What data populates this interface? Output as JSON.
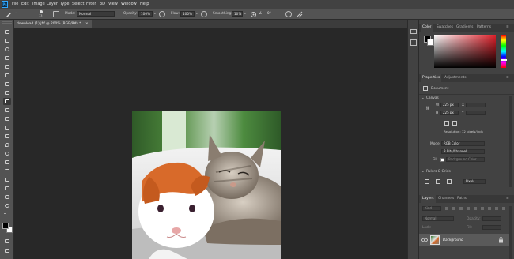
{
  "app": {
    "logo": "Ps"
  },
  "menu": [
    "File",
    "Edit",
    "Image",
    "Layer",
    "Type",
    "Select",
    "Filter",
    "3D",
    "View",
    "Window",
    "Help"
  ],
  "options": {
    "brush_size": "13",
    "mode_label": "Mode:",
    "mode_value": "Normal",
    "opacity_label": "Opacity:",
    "opacity_value": "100%",
    "flow_label": "Flow:",
    "flow_value": "100%",
    "smoothing_label": "Smoothing:",
    "smoothing_value": "10%",
    "angle_value": "0°"
  },
  "document": {
    "tab_title": "download (1).jfif @ 200% (RGB/8#) *",
    "close": "×"
  },
  "color_panel": {
    "tabs": [
      "Color",
      "Swatches",
      "Gradients",
      "Patterns"
    ],
    "foreground": "#000000",
    "background": "#ffffff"
  },
  "properties": {
    "tabs": [
      "Properties",
      "Adjustments"
    ],
    "doc_type": "Document",
    "canvas_header": "Canvas",
    "w_label": "W",
    "w_value": "225 px",
    "h_label": "H",
    "h_value": "225 px",
    "x_label": "X",
    "y_label": "Y",
    "resolution": "Resolution: 72 pixels/inch",
    "mode_label": "Mode",
    "mode_value": "RGB Color",
    "depth_value": "8 Bits/Channel",
    "fill_label": "Fill",
    "fill_value": "Background Color",
    "rulers_header": "Rulers & Grids",
    "units_value": "Pixels"
  },
  "layers": {
    "tabs": [
      "Layers",
      "Channels",
      "Paths"
    ],
    "kind_value": "Kind",
    "blend_value": "Normal",
    "opacity_label": "Opacity:",
    "fill_label": "Fill:",
    "lock_label": "Lock:",
    "layer_name": "Background"
  },
  "icons": [
    "brush-icon",
    "lock-icon",
    "eye-icon",
    "gear-icon"
  ]
}
